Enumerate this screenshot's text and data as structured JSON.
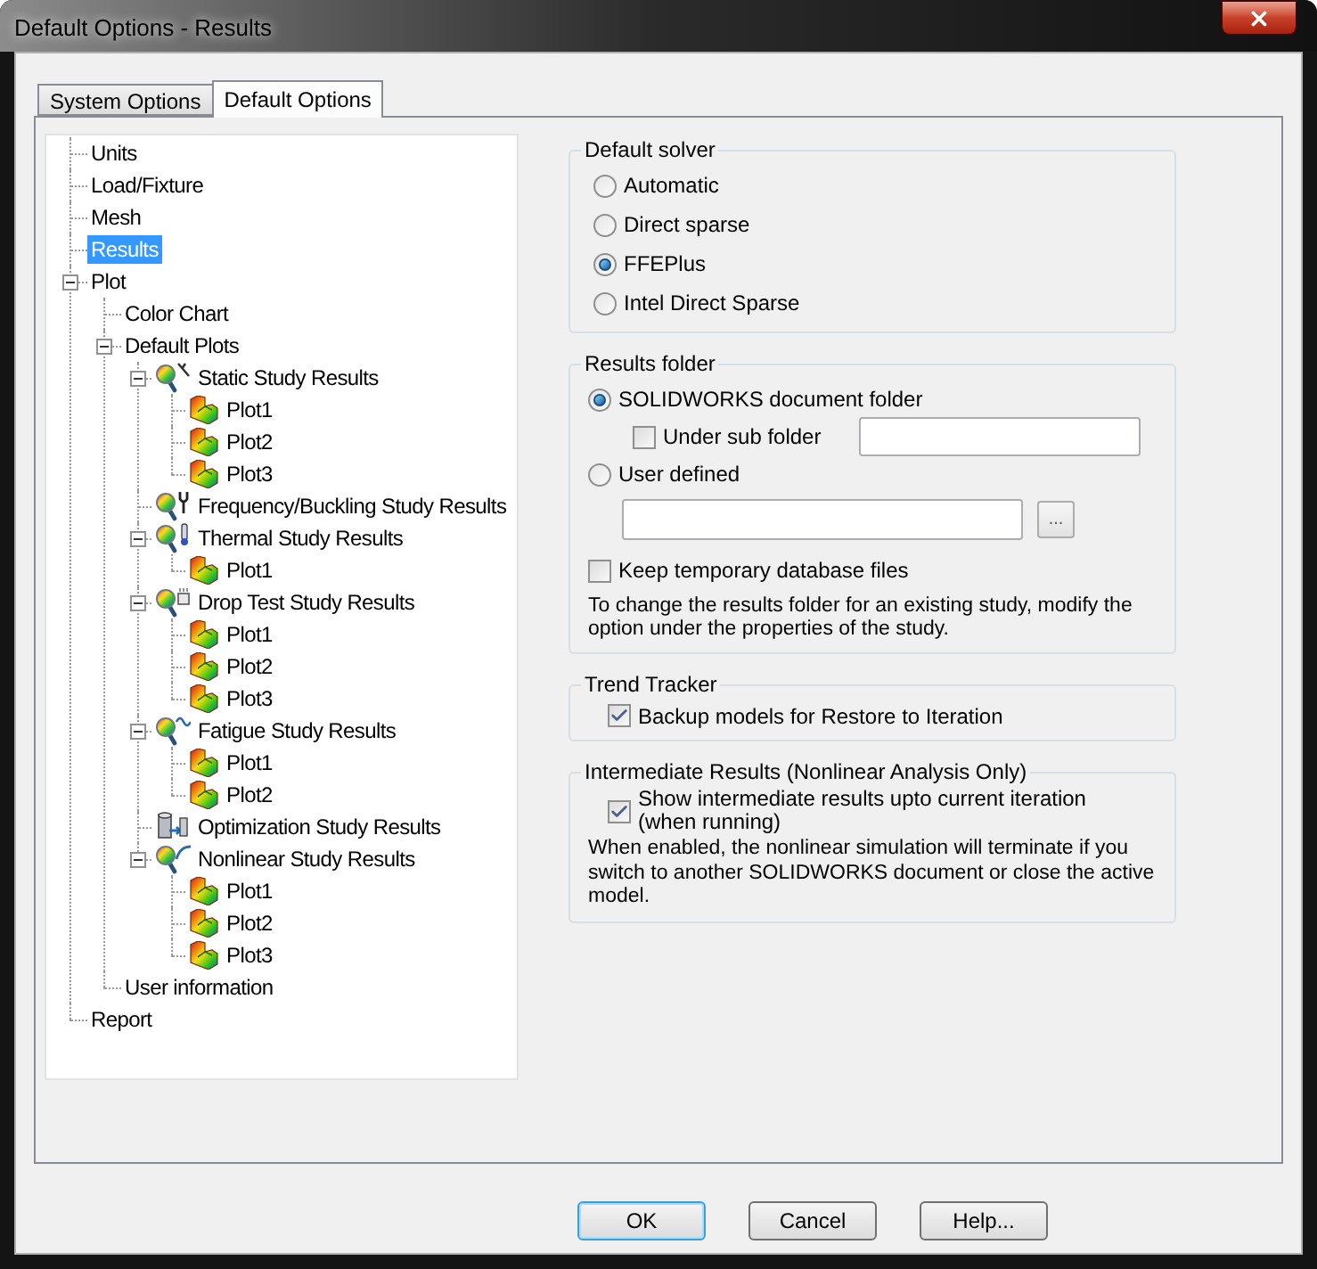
{
  "window": {
    "title": "Default Options - Results"
  },
  "tabs": [
    {
      "label": "System Options",
      "selected": false
    },
    {
      "label": "Default Options",
      "selected": true
    }
  ],
  "tree": [
    {
      "label": "Units",
      "kind": "item",
      "selected": false
    },
    {
      "label": "Load/Fixture",
      "kind": "item",
      "selected": false
    },
    {
      "label": "Mesh",
      "kind": "item",
      "selected": false
    },
    {
      "label": "Results",
      "kind": "item",
      "selected": true
    },
    {
      "label": "Plot",
      "kind": "item",
      "selected": false,
      "expanded": true,
      "children": [
        {
          "label": "Color Chart",
          "kind": "item",
          "selected": false
        },
        {
          "label": "Default Plots",
          "kind": "item",
          "selected": false,
          "expanded": true,
          "children": [
            {
              "label": "Static Study Results",
              "kind": "static",
              "selected": false,
              "expanded": true,
              "children": [
                {
                  "label": "Plot1",
                  "kind": "plot",
                  "selected": false
                },
                {
                  "label": "Plot2",
                  "kind": "plot",
                  "selected": false
                },
                {
                  "label": "Plot3",
                  "kind": "plot",
                  "selected": false
                }
              ]
            },
            {
              "label": "Frequency/Buckling Study Results",
              "kind": "frequency",
              "selected": false
            },
            {
              "label": "Thermal Study Results",
              "kind": "thermal",
              "selected": false,
              "expanded": true,
              "children": [
                {
                  "label": "Plot1",
                  "kind": "plot",
                  "selected": false
                }
              ]
            },
            {
              "label": "Drop Test Study Results",
              "kind": "droptest",
              "selected": false,
              "expanded": true,
              "children": [
                {
                  "label": "Plot1",
                  "kind": "plot",
                  "selected": false
                },
                {
                  "label": "Plot2",
                  "kind": "plot",
                  "selected": false
                },
                {
                  "label": "Plot3",
                  "kind": "plot",
                  "selected": false
                }
              ]
            },
            {
              "label": "Fatigue Study Results",
              "kind": "fatigue",
              "selected": false,
              "expanded": true,
              "children": [
                {
                  "label": "Plot1",
                  "kind": "plot",
                  "selected": false
                },
                {
                  "label": "Plot2",
                  "kind": "plot",
                  "selected": false
                }
              ]
            },
            {
              "label": "Optimization Study Results",
              "kind": "optimization",
              "selected": false
            },
            {
              "label": "Nonlinear Study Results",
              "kind": "nonlinear",
              "selected": false,
              "expanded": true,
              "children": [
                {
                  "label": "Plot1",
                  "kind": "plot",
                  "selected": false
                },
                {
                  "label": "Plot2",
                  "kind": "plot",
                  "selected": false
                },
                {
                  "label": "Plot3",
                  "kind": "plot",
                  "selected": false
                }
              ]
            }
          ]
        },
        {
          "label": "User information",
          "kind": "item",
          "selected": false
        }
      ]
    },
    {
      "label": "Report",
      "kind": "item",
      "selected": false
    }
  ],
  "default_solver": {
    "title": "Default solver",
    "options": [
      {
        "label": "Automatic",
        "selected": false
      },
      {
        "label": "Direct sparse",
        "selected": false
      },
      {
        "label": "FFEPlus",
        "selected": true
      },
      {
        "label": "Intel Direct Sparse",
        "selected": false
      }
    ]
  },
  "results_folder": {
    "title": "Results folder",
    "document_folder": {
      "label": "SOLIDWORKS document folder",
      "selected": true
    },
    "sub_folder": {
      "label": "Under sub folder",
      "checked": false
    },
    "user_defined": {
      "label": "User defined",
      "selected": false
    },
    "browse_button": "...",
    "keep_temp": {
      "label": "Keep temporary database files",
      "checked": false
    },
    "note": "To change the results folder for an existing study, modify the option under the properties of the study."
  },
  "trend_tracker": {
    "title": "Trend Tracker",
    "backup": {
      "label": "Backup models for Restore to Iteration",
      "checked": true
    }
  },
  "intermediate_results": {
    "title": "Intermediate Results (Nonlinear Analysis Only)",
    "show": {
      "label": "Show intermediate results upto current iteration (when running)",
      "checked": true
    },
    "note": "When enabled, the nonlinear simulation will terminate if you switch to another SOLIDWORKS document or close the active model."
  },
  "buttons": [
    {
      "label": "OK",
      "default": true
    },
    {
      "label": "Cancel",
      "default": false
    },
    {
      "label": "Help...",
      "default": false
    }
  ]
}
